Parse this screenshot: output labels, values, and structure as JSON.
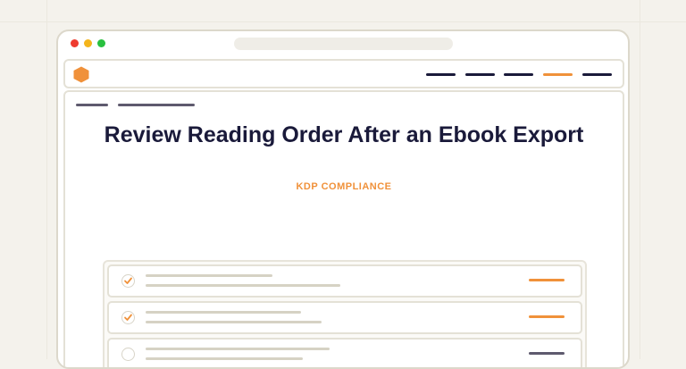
{
  "page": {
    "title": "Review Reading Order After an Ebook Export",
    "category": "KDP COMPLIANCE"
  },
  "colors": {
    "accent": "#f0913a",
    "navy": "#1a1a3a",
    "muted": "#5e5a6e",
    "placeholder": "#d6d2c4"
  },
  "navbar": {
    "logo_icon": "hexagon-logo-icon",
    "active_index": 3,
    "items": [
      {
        "icon": "nav-item-placeholder",
        "active": false
      },
      {
        "icon": "nav-item-placeholder",
        "active": false
      },
      {
        "icon": "nav-item-placeholder",
        "active": false
      },
      {
        "icon": "nav-item-placeholder",
        "active": true
      },
      {
        "icon": "nav-item-placeholder",
        "active": false
      }
    ]
  },
  "checklist": {
    "items": [
      {
        "checked": true,
        "status": "complete"
      },
      {
        "checked": true,
        "status": "complete"
      },
      {
        "checked": false,
        "status": "pending"
      }
    ]
  }
}
